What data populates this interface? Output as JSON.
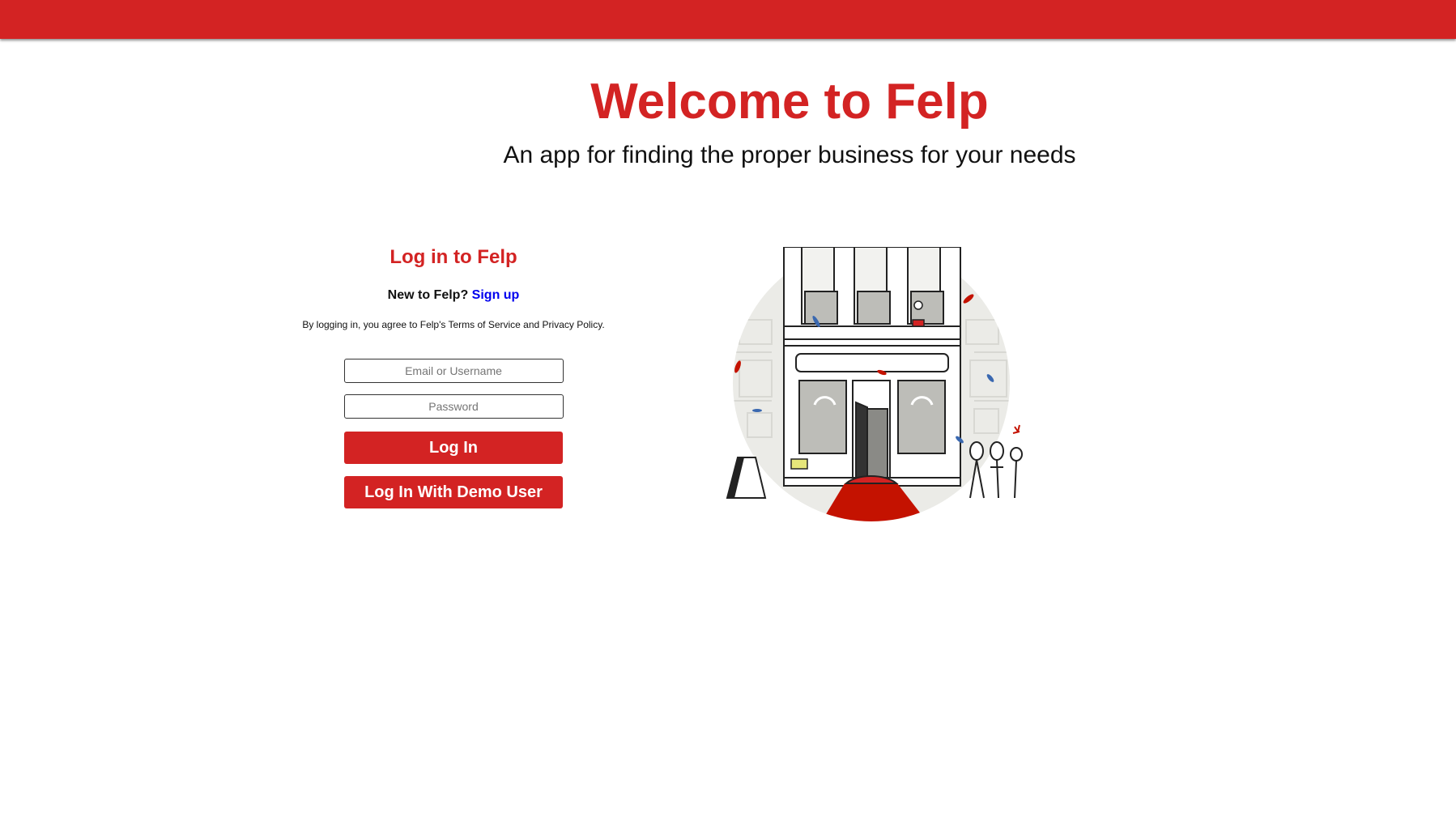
{
  "header": {
    "brand_color": "#d32323"
  },
  "hero": {
    "title": "Welcome to Felp",
    "subtitle": "An app for finding the proper business for your needs"
  },
  "login": {
    "title": "Log in to Felp",
    "new_to_prefix": "New to Felp?",
    "signup_link": "Sign up",
    "terms_text": "By logging in, you agree to Felp's Terms of Service and Privacy Policy.",
    "email_placeholder": "Email or Username",
    "password_placeholder": "Password",
    "login_button": "Log In",
    "demo_button": "Log In With Demo User"
  },
  "illustration": {
    "icon": "storefront-illustration",
    "accent_color": "#c41200"
  }
}
